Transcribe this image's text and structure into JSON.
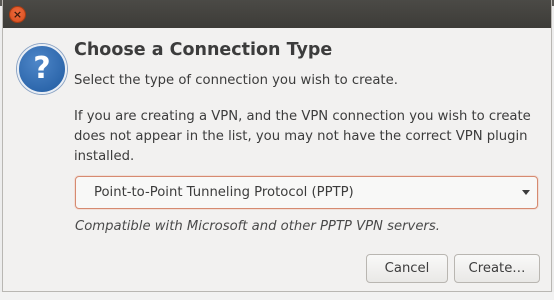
{
  "window": {
    "close_glyph": "×"
  },
  "dialog": {
    "icon": "help-icon",
    "icon_glyph": "?",
    "title": "Choose a Connection Type",
    "subtitle": "Select the type of connection you wish to create.",
    "info": "If you are creating a VPN, and the VPN connection you wish to create does not appear in the list, you may not have the correct VPN plugin installed.",
    "connection_type": {
      "selected": "Point-to-Point Tunneling Protocol (PPTP)"
    },
    "description": "Compatible with Microsoft and other PPTP VPN servers.",
    "buttons": {
      "cancel": "Cancel",
      "create": "Create…"
    }
  },
  "colors": {
    "accent_border": "#d68a70",
    "close_button": "#e95420",
    "help_icon": "#2b67b0"
  }
}
